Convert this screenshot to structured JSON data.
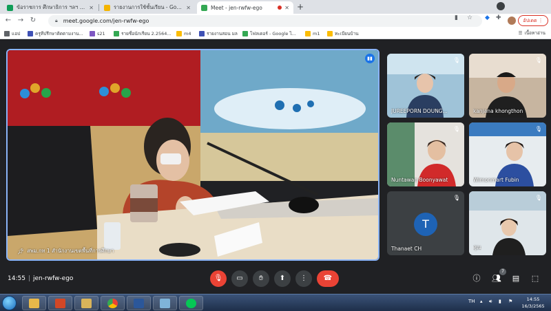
{
  "browser": {
    "tabs": [
      {
        "title": "ข้อราชการ ศึกษาธิการ ฯลฯ ม.ต้น",
        "color": "#0f9d58",
        "active": false
      },
      {
        "title": "รายงานการใช้ชั้นเรียน - Google ไ",
        "color": "#f4b400",
        "active": false
      },
      {
        "title": "Meet - jen-rwfw-ego",
        "color": "#34a853",
        "active": true
      }
    ],
    "url": "meet.google.com/jen-rwfw-ego",
    "profile_label": "อัปเดต",
    "bookmarks": [
      {
        "label": "แอป",
        "color": "#5f6368"
      },
      {
        "label": "ครูทีปรึกษาติดตามงาน...",
        "color": "#3f51b5"
      },
      {
        "label": "s21",
        "color": "#7e57c2"
      },
      {
        "label": "รายชื่อนักเรียน 2.2564...",
        "color": "#34a853"
      },
      {
        "label": "m4",
        "color": "#fbbc04"
      },
      {
        "label": "รายงานสอน มล",
        "color": "#3f51b5"
      },
      {
        "label": "โฟลเดอร์ - Google ไ...",
        "color": "#34a853"
      },
      {
        "label": "m1",
        "color": "#fbbc04"
      },
      {
        "label": "ทะเบียนบ้าน",
        "color": "#fbbc04"
      }
    ],
    "bookmarks_right": "เนื้อหาอ่าน"
  },
  "meet": {
    "main_participant": "สพม.กท 1 สำนักงานเขตพื้นที่การศึกษา",
    "participants": [
      {
        "name": "JUREEPORN DOUNG...",
        "muted": true
      },
      {
        "name": "kanjana khongthon",
        "muted": true
      },
      {
        "name": "Nuntawan Boonyawat",
        "muted": true
      },
      {
        "name": "Wimonmart Fubin",
        "muted": true
      },
      {
        "name": "Thanaet CH",
        "muted": true,
        "avatar_letter": "T"
      },
      {
        "name": "ศุณ",
        "muted": true
      }
    ],
    "time": "14:55",
    "meeting_code": "jen-rwfw-ego",
    "people_count": "7",
    "icons": {
      "mic": "mic-off-icon",
      "camera": "camera-icon",
      "hand": "raise-hand-icon",
      "present": "present-icon",
      "more": "more-vert-icon",
      "end": "end-call-icon",
      "info": "info-icon",
      "people": "people-icon",
      "chat": "chat-icon",
      "activities": "activities-icon"
    },
    "colors": {
      "end_call": "#ea4335",
      "mic_off": "#ea4335",
      "speaking_border": "#8ab4f8",
      "avatar": "#1e63b5"
    }
  },
  "taskbar": {
    "lang": "TH",
    "time": "14:55",
    "date": "16/3/2565"
  }
}
